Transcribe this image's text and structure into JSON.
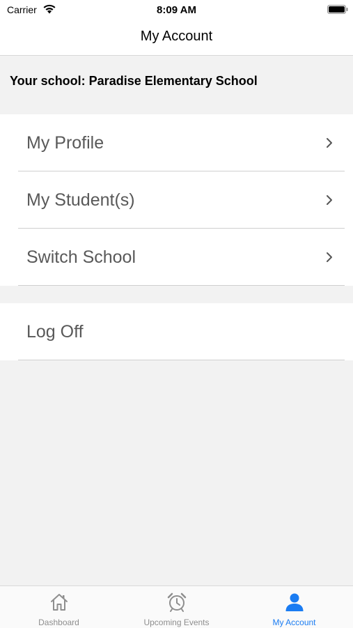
{
  "status_bar": {
    "carrier": "Carrier",
    "time": "8:09 AM"
  },
  "nav": {
    "title": "My Account"
  },
  "school": {
    "label": "Your school: Paradise Elementary School"
  },
  "menu": {
    "items": [
      {
        "label": "My Profile",
        "icon": "chevron-right-icon"
      },
      {
        "label": "My Student(s)",
        "icon": "chevron-right-icon"
      },
      {
        "label": "Switch School",
        "icon": "chevron-right-icon"
      }
    ],
    "logoff": {
      "label": "Log Off"
    }
  },
  "tab_bar": {
    "tabs": [
      {
        "label": "Dashboard",
        "icon": "house-icon",
        "active": false
      },
      {
        "label": "Upcoming Events",
        "icon": "alarm-clock-icon",
        "active": false
      },
      {
        "label": "My Account",
        "icon": "person-icon",
        "active": true
      }
    ]
  },
  "colors": {
    "accent": "#1a7cf2",
    "inactive_tab": "#8e8e8e",
    "background": "#f2f2f2",
    "row_text": "#595959"
  }
}
